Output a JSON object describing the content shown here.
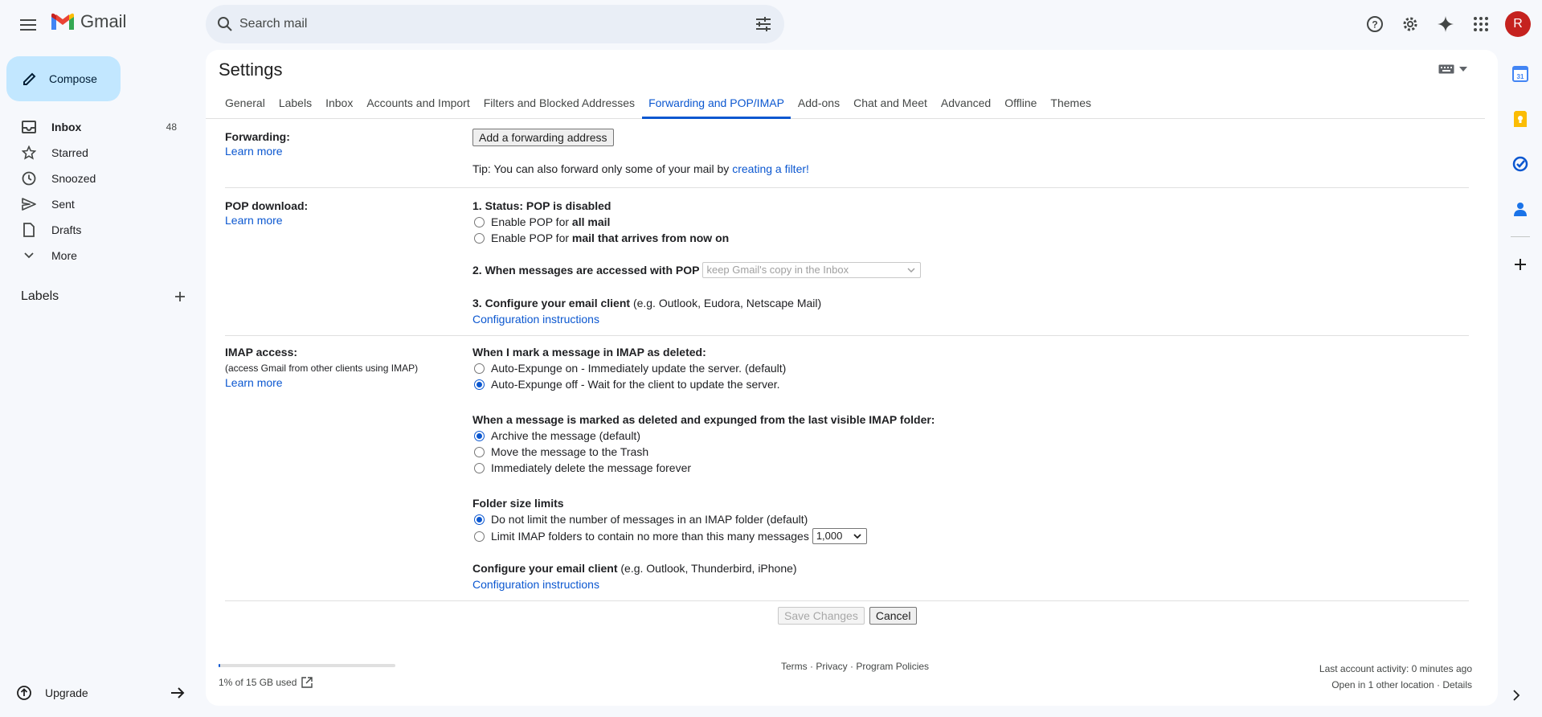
{
  "app": {
    "name": "Gmail"
  },
  "search": {
    "placeholder": "Search mail"
  },
  "account": {
    "initial": "R"
  },
  "compose": {
    "label": "Compose"
  },
  "nav": {
    "inbox": {
      "label": "Inbox",
      "count": "48"
    },
    "starred": {
      "label": "Starred"
    },
    "snoozed": {
      "label": "Snoozed"
    },
    "sent": {
      "label": "Sent"
    },
    "drafts": {
      "label": "Drafts"
    },
    "more": {
      "label": "More"
    }
  },
  "labels": {
    "title": "Labels"
  },
  "upgrade": {
    "label": "Upgrade"
  },
  "settings": {
    "title": "Settings",
    "tabs": {
      "general": "General",
      "labels": "Labels",
      "inbox": "Inbox",
      "accounts": "Accounts and Import",
      "filters": "Filters and Blocked Addresses",
      "forwarding": "Forwarding and POP/IMAP",
      "addons": "Add-ons",
      "chat": "Chat and Meet",
      "advanced": "Advanced",
      "offline": "Offline",
      "themes": "Themes"
    },
    "active_tab": "Forwarding and POP/IMAP"
  },
  "forwarding": {
    "title": "Forwarding:",
    "learn_more": "Learn more",
    "add_button": "Add a forwarding address",
    "tip_prefix": "Tip: You can also forward only some of your mail by ",
    "tip_link": "creating a filter!"
  },
  "pop": {
    "title": "POP download:",
    "learn_more": "Learn more",
    "status": "1. Status: POP is disabled",
    "opt_all_prefix": "Enable POP for ",
    "opt_all_bold": "all mail",
    "opt_now_prefix": "Enable POP for ",
    "opt_now_bold": "mail that arrives from now on",
    "access_label": "2. When messages are accessed with POP",
    "access_select": "keep Gmail's copy in the Inbox",
    "configure_bold": "3. Configure your email client",
    "configure_rest": " (e.g. Outlook, Eudora, Netscape Mail)",
    "config_link": "Configuration instructions"
  },
  "imap": {
    "title": "IMAP access:",
    "subtitle": "(access Gmail from other clients using IMAP)",
    "learn_more": "Learn more",
    "deleted_heading": "When I mark a message in IMAP as deleted:",
    "expunge_on": "Auto-Expunge on - Immediately update the server. (default)",
    "expunge_off": "Auto-Expunge off - Wait for the client to update the server.",
    "expunged_heading": "When a message is marked as deleted and expunged from the last visible IMAP folder:",
    "archive": "Archive the message (default)",
    "trash": "Move the message to the Trash",
    "delete_forever": "Immediately delete the message forever",
    "folder_heading": "Folder size limits",
    "no_limit": "Do not limit the number of messages in an IMAP folder (default)",
    "limit": "Limit IMAP folders to contain no more than this many messages",
    "limit_value": "1,000",
    "configure_bold": "Configure your email client",
    "configure_rest": " (e.g. Outlook, Thunderbird, iPhone)",
    "config_link": "Configuration instructions"
  },
  "actions": {
    "save": "Save Changes",
    "cancel": "Cancel"
  },
  "footer": {
    "storage_text": "1% of 15 GB used",
    "storage_fraction": 0.01,
    "terms": "Terms",
    "privacy": "Privacy",
    "policies": "Program Policies",
    "sep": " · ",
    "activity": "Last account activity: 0 minutes ago",
    "other_location": "Open in 1 other location",
    "details": "Details"
  },
  "colors": {
    "accent": "#0b57d0",
    "compose_bg": "#c2e7ff",
    "avatar": "#c5221f"
  }
}
